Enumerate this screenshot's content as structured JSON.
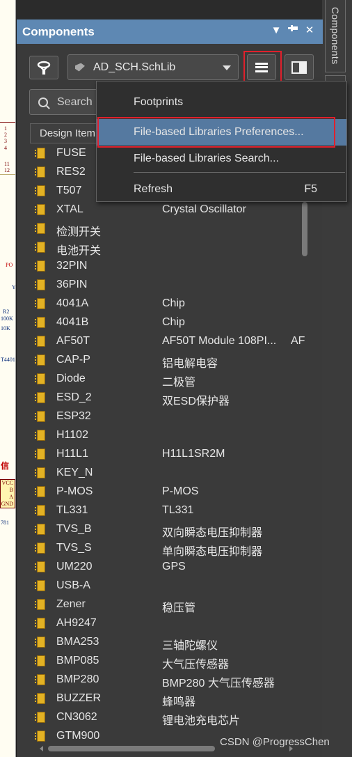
{
  "panel": {
    "title": "Components",
    "title_controls": [
      "▼",
      "📌",
      "✕"
    ]
  },
  "side_tab": {
    "label": "Components"
  },
  "toolbar": {
    "library": "AD_SCH.SchLib"
  },
  "search": {
    "placeholder": "Search"
  },
  "table": {
    "header": "Design Item",
    "rows": [
      {
        "name": "FUSE",
        "desc": ""
      },
      {
        "name": "RES2",
        "desc": ""
      },
      {
        "name": "T507",
        "desc": ""
      },
      {
        "name": "XTAL",
        "desc": "Crystal Oscillator"
      },
      {
        "name": "检测开关",
        "desc": ""
      },
      {
        "name": "电池开关",
        "desc": ""
      },
      {
        "name": "32PIN",
        "desc": ""
      },
      {
        "name": "36PIN",
        "desc": ""
      },
      {
        "name": "4041A",
        "desc": "Chip"
      },
      {
        "name": "4041B",
        "desc": "Chip"
      },
      {
        "name": "AF50T",
        "desc": "AF50T Module 108PI...",
        "extra": "AF"
      },
      {
        "name": "CAP-P",
        "desc": "铝电解电容"
      },
      {
        "name": "Diode",
        "desc": "二极管"
      },
      {
        "name": "ESD_2",
        "desc": "双ESD保护器"
      },
      {
        "name": "ESP32",
        "desc": ""
      },
      {
        "name": "H1102",
        "desc": ""
      },
      {
        "name": "H11L1",
        "desc": "H11L1SR2M"
      },
      {
        "name": "KEY_N",
        "desc": ""
      },
      {
        "name": "P-MOS",
        "desc": "P-MOS"
      },
      {
        "name": "TL331",
        "desc": "TL331"
      },
      {
        "name": "TVS_B",
        "desc": "双向瞬态电压抑制器"
      },
      {
        "name": "TVS_S",
        "desc": "单向瞬态电压抑制器"
      },
      {
        "name": "UM220",
        "desc": "GPS"
      },
      {
        "name": "USB-A",
        "desc": ""
      },
      {
        "name": "Zener",
        "desc": "稳压管"
      },
      {
        "name": "AH9247",
        "desc": ""
      },
      {
        "name": "BMA253",
        "desc": "三轴陀螺仪"
      },
      {
        "name": "BMP085",
        "desc": "大气压传感器"
      },
      {
        "name": "BMP280",
        "desc": "BMP280 大气压传感器"
      },
      {
        "name": "BUZZER",
        "desc": "蜂鸣器"
      },
      {
        "name": "CN3062",
        "desc": "锂电池充电芯片"
      },
      {
        "name": "GTM900",
        "desc": ""
      }
    ]
  },
  "menu": {
    "items": [
      {
        "label": "Footprints",
        "shortcut": ""
      },
      {
        "label": "File-based Libraries Preferences...",
        "shortcut": ""
      },
      {
        "label": "File-based Libraries Search...",
        "shortcut": ""
      },
      {
        "label": "Refresh",
        "shortcut": "F5"
      }
    ]
  },
  "schematic": {
    "pins": [
      "1",
      "2",
      "3",
      "4",
      "11",
      "12"
    ],
    "labels": [
      "PO",
      "Y",
      "R2",
      "100K",
      "10K",
      "T4401",
      "信",
      "781"
    ],
    "box_pins": [
      "VCC",
      "B",
      "A",
      "GND"
    ]
  },
  "watermark": "CSDN @ProgressChen",
  "colors": {
    "titlebar": "#5e88b3",
    "menu_active": "#5579a0",
    "highlight_box": "#e0202c",
    "component_icon": "#e3b224"
  }
}
